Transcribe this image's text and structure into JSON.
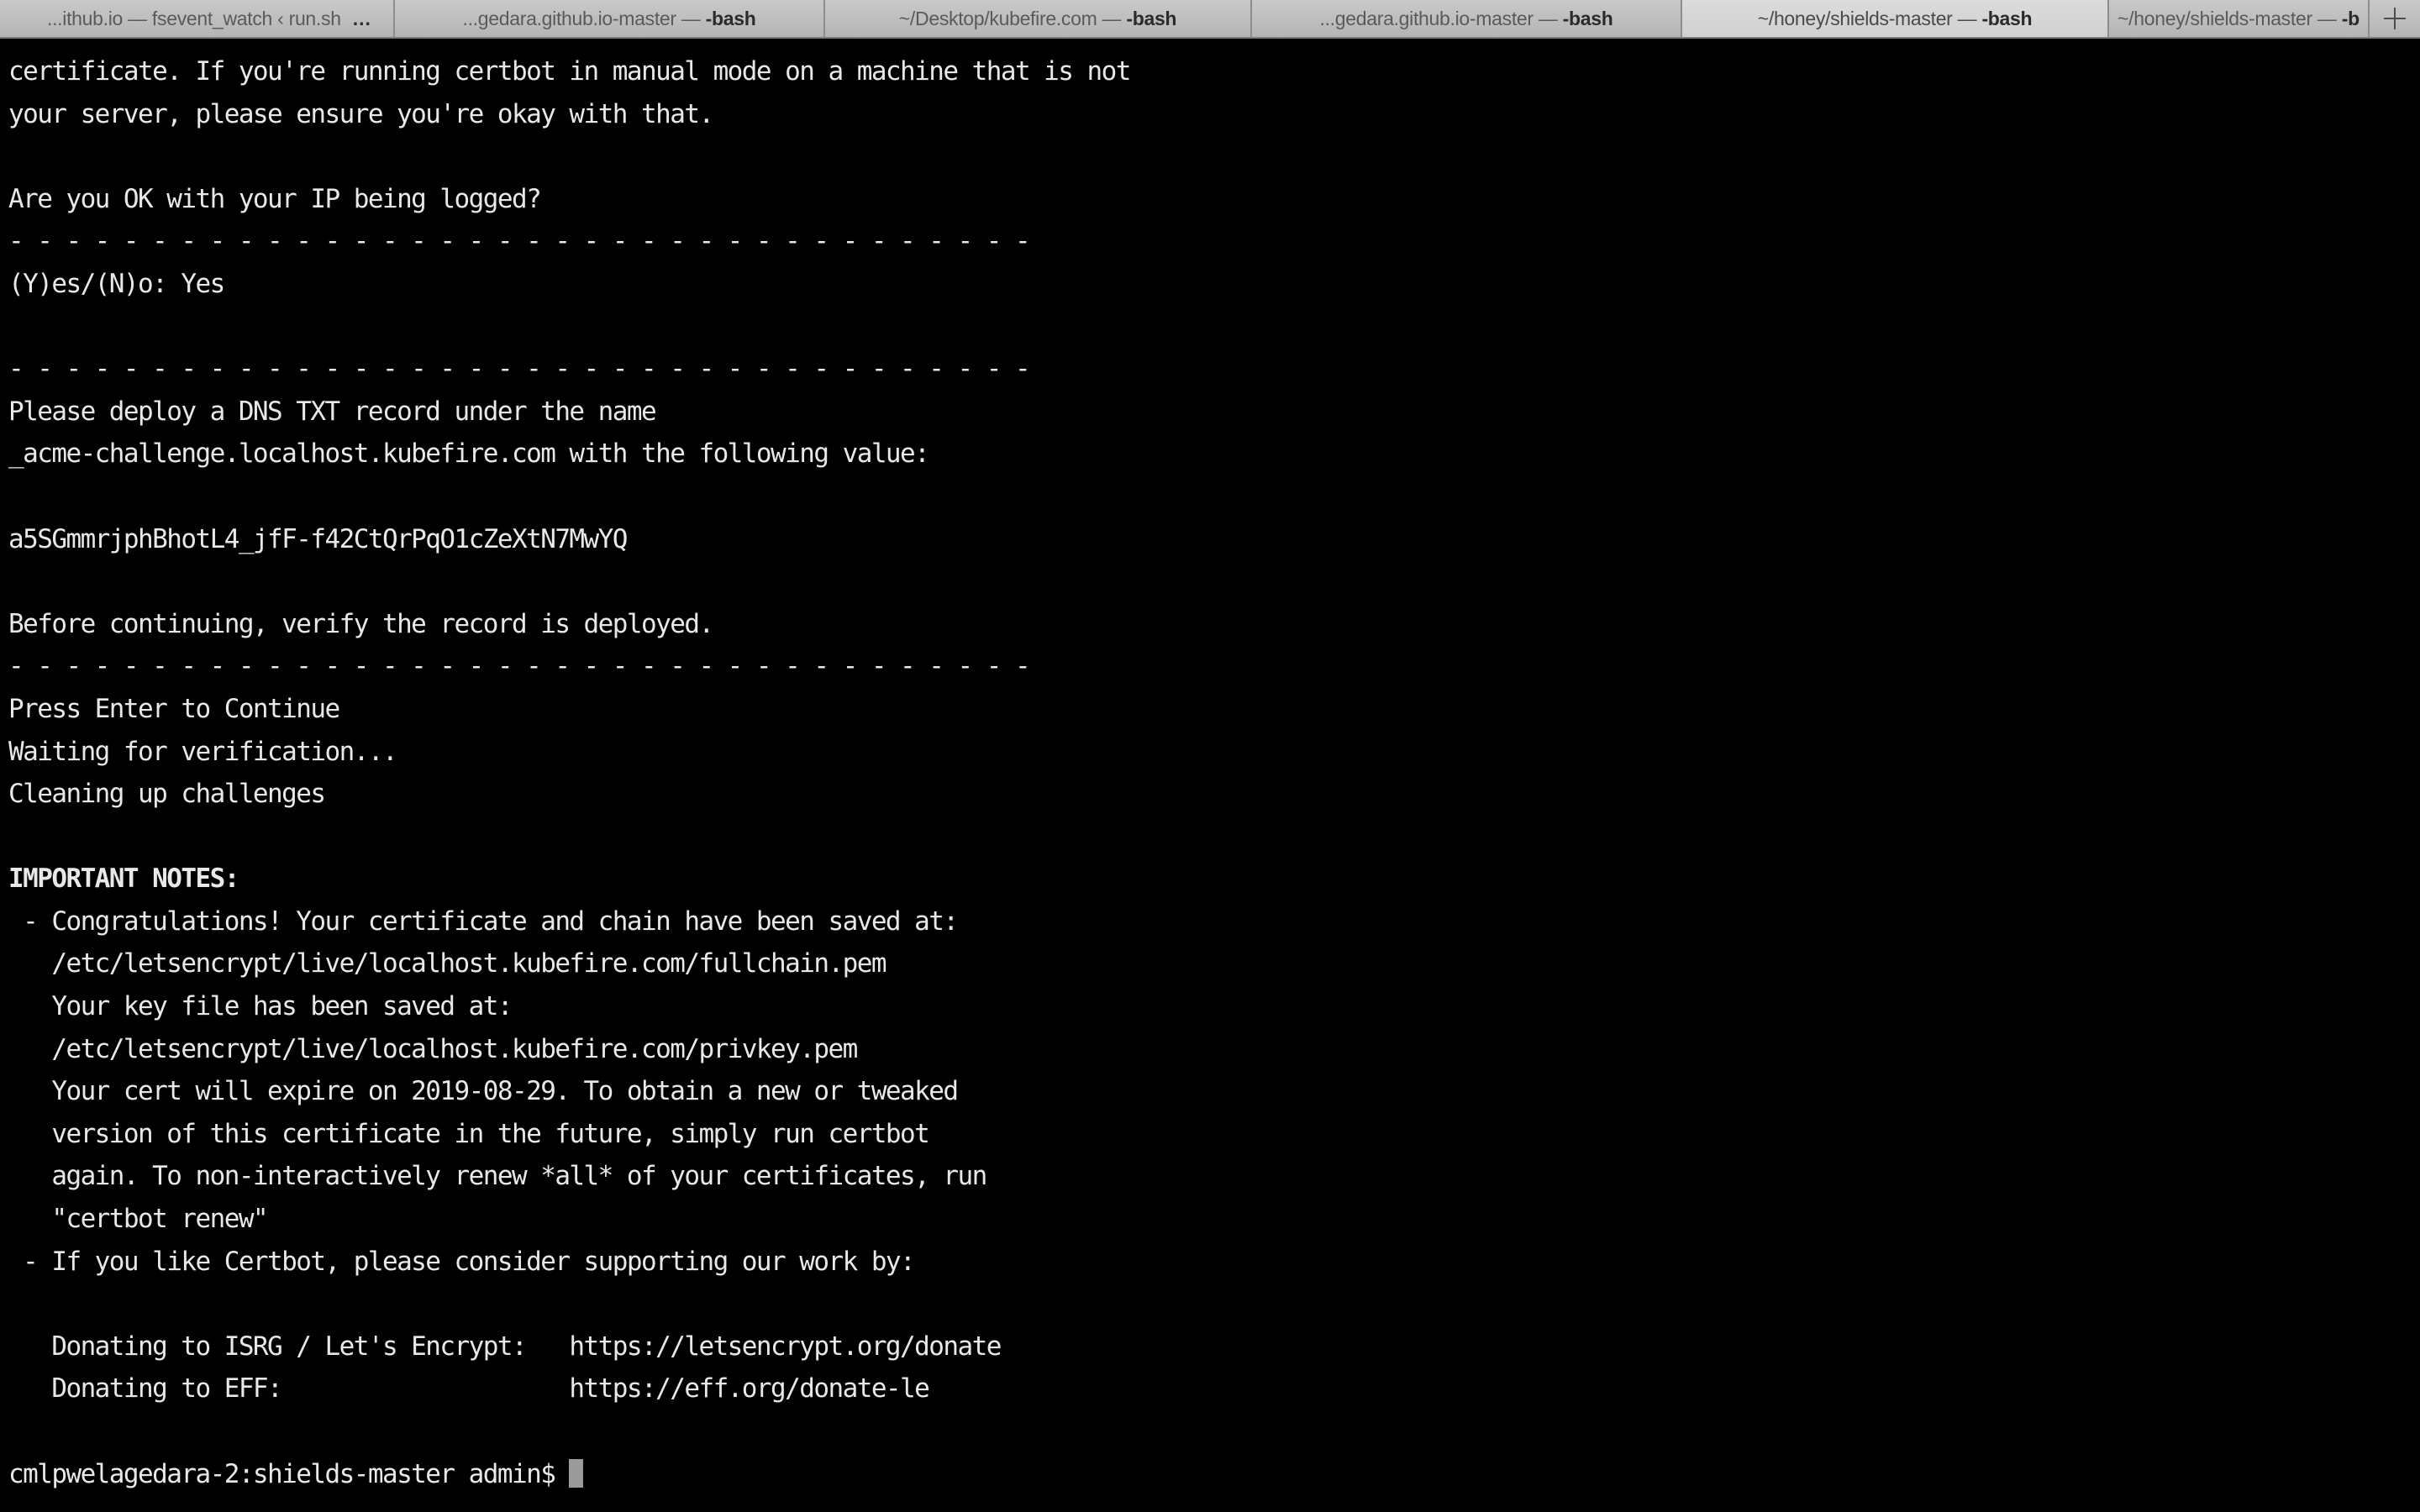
{
  "window": {
    "app": "Terminal",
    "new_tab_label": "+",
    "new_tab_icon": "plus-icon"
  },
  "tabs": [
    {
      "id": "tab-0",
      "prefix": "...ithub.io — fsevent_watch ‹ run.sh",
      "bold_suffix": "",
      "ellipsis": "...",
      "active": false
    },
    {
      "id": "tab-1",
      "prefix": "...gedara.github.io-master — ",
      "bold_suffix": "-bash",
      "ellipsis": "",
      "active": false
    },
    {
      "id": "tab-2",
      "prefix": "~/Desktop/kubefire.com — ",
      "bold_suffix": "-bash",
      "ellipsis": "",
      "active": false
    },
    {
      "id": "tab-3",
      "prefix": "...gedara.github.io-master — ",
      "bold_suffix": "-bash",
      "ellipsis": "",
      "active": false
    },
    {
      "id": "tab-4",
      "prefix": "~/honey/shields-master — ",
      "bold_suffix": "-bash",
      "ellipsis": "",
      "active": true
    },
    {
      "id": "tab-5",
      "prefix": "~/honey/shields-master — ",
      "bold_suffix": "-bash",
      "ellipsis": "",
      "active": false
    }
  ],
  "colors": {
    "terminal_background": "#000000",
    "terminal_foreground": "#e8e8e8",
    "cursor": "#9a9a9a",
    "tabbar_background": "#bcbcbc",
    "tab_active_background": "#d6d6d6",
    "tab_inactive_text": "#5a5a5a"
  },
  "terminal": {
    "separator": "- - - - - - - - - - - - - - - - - - - - - - - - - - - - - - - - - - - -",
    "lines": [
      "certificate. If you're running certbot in manual mode on a machine that is not",
      "your server, please ensure you're okay with that.",
      "",
      "Are you OK with your IP being logged?",
      "- - - - - - - - - - - - - - - - - - - - - - - - - - - - - - - - - - - -",
      "(Y)es/(N)o: Yes",
      "",
      "- - - - - - - - - - - - - - - - - - - - - - - - - - - - - - - - - - - -",
      "Please deploy a DNS TXT record under the name",
      "_acme-challenge.localhost.kubefire.com with the following value:",
      "",
      "a5SGmmrjphBhotL4_jfF-f42CtQrPqO1cZeXtN7MwYQ",
      "",
      "Before continuing, verify the record is deployed.",
      "- - - - - - - - - - - - - - - - - - - - - - - - - - - - - - - - - - - -",
      "Press Enter to Continue",
      "Waiting for verification...",
      "Cleaning up challenges",
      "",
      "IMPORTANT NOTES:",
      " - Congratulations! Your certificate and chain have been saved at:",
      "   /etc/letsencrypt/live/localhost.kubefire.com/fullchain.pem",
      "   Your key file has been saved at:",
      "   /etc/letsencrypt/live/localhost.kubefire.com/privkey.pem",
      "   Your cert will expire on 2019-08-29. To obtain a new or tweaked",
      "   version of this certificate in the future, simply run certbot",
      "   again. To non-interactively renew *all* of your certificates, run",
      "   \"certbot renew\"",
      " - If you like Certbot, please consider supporting our work by:",
      "",
      "   Donating to ISRG / Let's Encrypt:   https://letsencrypt.org/donate",
      "   Donating to EFF:                    https://eff.org/donate-le",
      ""
    ],
    "bold_line_indexes": [
      19
    ],
    "challenge_value": "a5SGmmrjphBhotL4_jfF-f42CtQrPqO1cZeXtN7MwYQ",
    "dns_record_name": "_acme-challenge.localhost.kubefire.com",
    "fullchain_path": "/etc/letsencrypt/live/localhost.kubefire.com/fullchain.pem",
    "privkey_path": "/etc/letsencrypt/live/localhost.kubefire.com/privkey.pem",
    "expiry_date": "2019-08-29",
    "donate_isrg_url": "https://letsencrypt.org/donate",
    "donate_eff_url": "https://eff.org/donate-le",
    "prompt": "cmlpwelagedara-2:shields-master admin$ ",
    "prompt_host": "cmlpwelagedara-2",
    "prompt_dir": "shields-master",
    "prompt_user": "admin",
    "input_value": ""
  }
}
